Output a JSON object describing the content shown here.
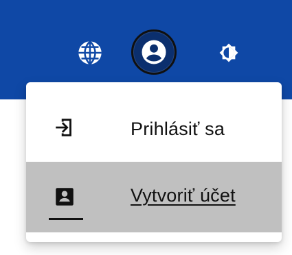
{
  "toolbar": {
    "language_icon": "globe-icon",
    "account_icon": "account-circle-icon",
    "theme_icon": "brightness-icon"
  },
  "menu": {
    "items": [
      {
        "label": "Prihlásiť sa",
        "icon": "login-icon"
      },
      {
        "label": "Vytvoriť účet",
        "icon": "contact-card-icon"
      }
    ]
  },
  "colors": {
    "app_bar": "#0f48a6",
    "menu_highlight": "#c0c0c0",
    "text": "#111111"
  }
}
